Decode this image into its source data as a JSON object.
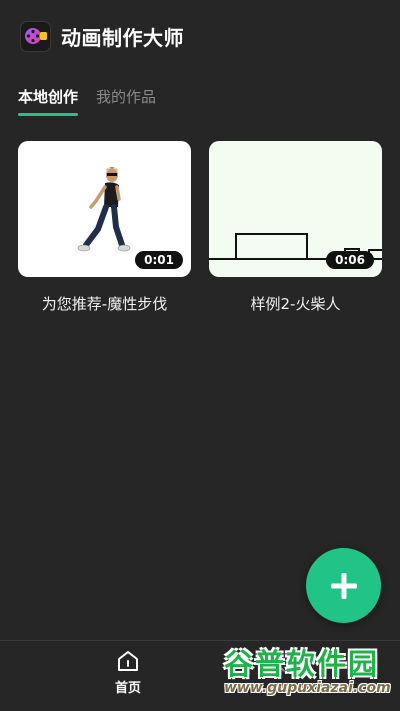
{
  "app": {
    "title": "动画制作大师"
  },
  "tabs": [
    {
      "label": "本地创作",
      "active": true
    },
    {
      "label": "我的作品",
      "active": false
    }
  ],
  "cards": [
    {
      "caption": "为您推荐-魔性步伐",
      "duration": "0:01"
    },
    {
      "caption": "样例2-火柴人",
      "duration": "0:06"
    }
  ],
  "fab": {
    "icon": "plus-icon"
  },
  "bottom_nav": {
    "home_label": "首页"
  },
  "watermark": {
    "title": "谷普软件园",
    "url": "www.gupuxiazai.com"
  },
  "colors": {
    "background": "#262626",
    "accent": "#22c386",
    "tab_inactive": "#8a8a8a"
  }
}
